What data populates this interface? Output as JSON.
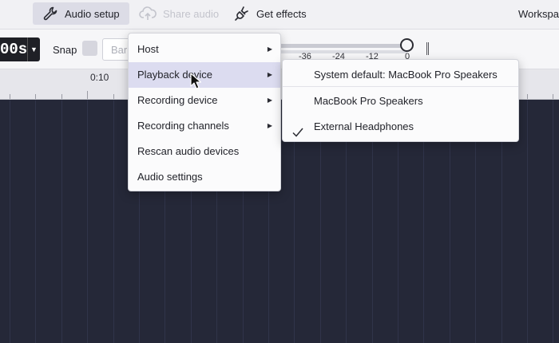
{
  "toolbar": {
    "audio_setup": "Audio setup",
    "share_audio": "Share audio",
    "get_effects": "Get effects",
    "workspace": "Workspa"
  },
  "controls": {
    "time_display": "00s",
    "snap_label": "Snap",
    "snap_value": "Bar",
    "meter_ticks": [
      "-36",
      "-24",
      "-12",
      "0"
    ]
  },
  "ruler": {
    "label": "0:10"
  },
  "audio_menu": {
    "items": [
      {
        "label": "Host",
        "submenu": true
      },
      {
        "label": "Playback device",
        "submenu": true,
        "highlighted": true
      },
      {
        "label": "Recording device",
        "submenu": true
      },
      {
        "label": "Recording channels",
        "submenu": true
      },
      {
        "label": "Rescan audio devices",
        "submenu": false
      },
      {
        "label": "Audio settings",
        "submenu": false
      }
    ]
  },
  "playback_submenu": {
    "items": [
      {
        "label": "System default: MacBook Pro Speakers",
        "checked": false
      },
      {
        "label": "MacBook Pro Speakers",
        "checked": false
      },
      {
        "label": "External Headphones",
        "checked": true
      }
    ]
  },
  "colors": {
    "track_bg": "#252838",
    "highlight": "#dcdcf0",
    "toolbar_bg": "#f1f1f4"
  },
  "icons": {
    "audio_setup": "wrench-icon",
    "share_audio": "cloud-upload-icon",
    "get_effects": "plug-icon",
    "submenu": "triangle-right-icon",
    "checked": "checkmark-icon",
    "cursor": "mouse-pointer-icon"
  }
}
